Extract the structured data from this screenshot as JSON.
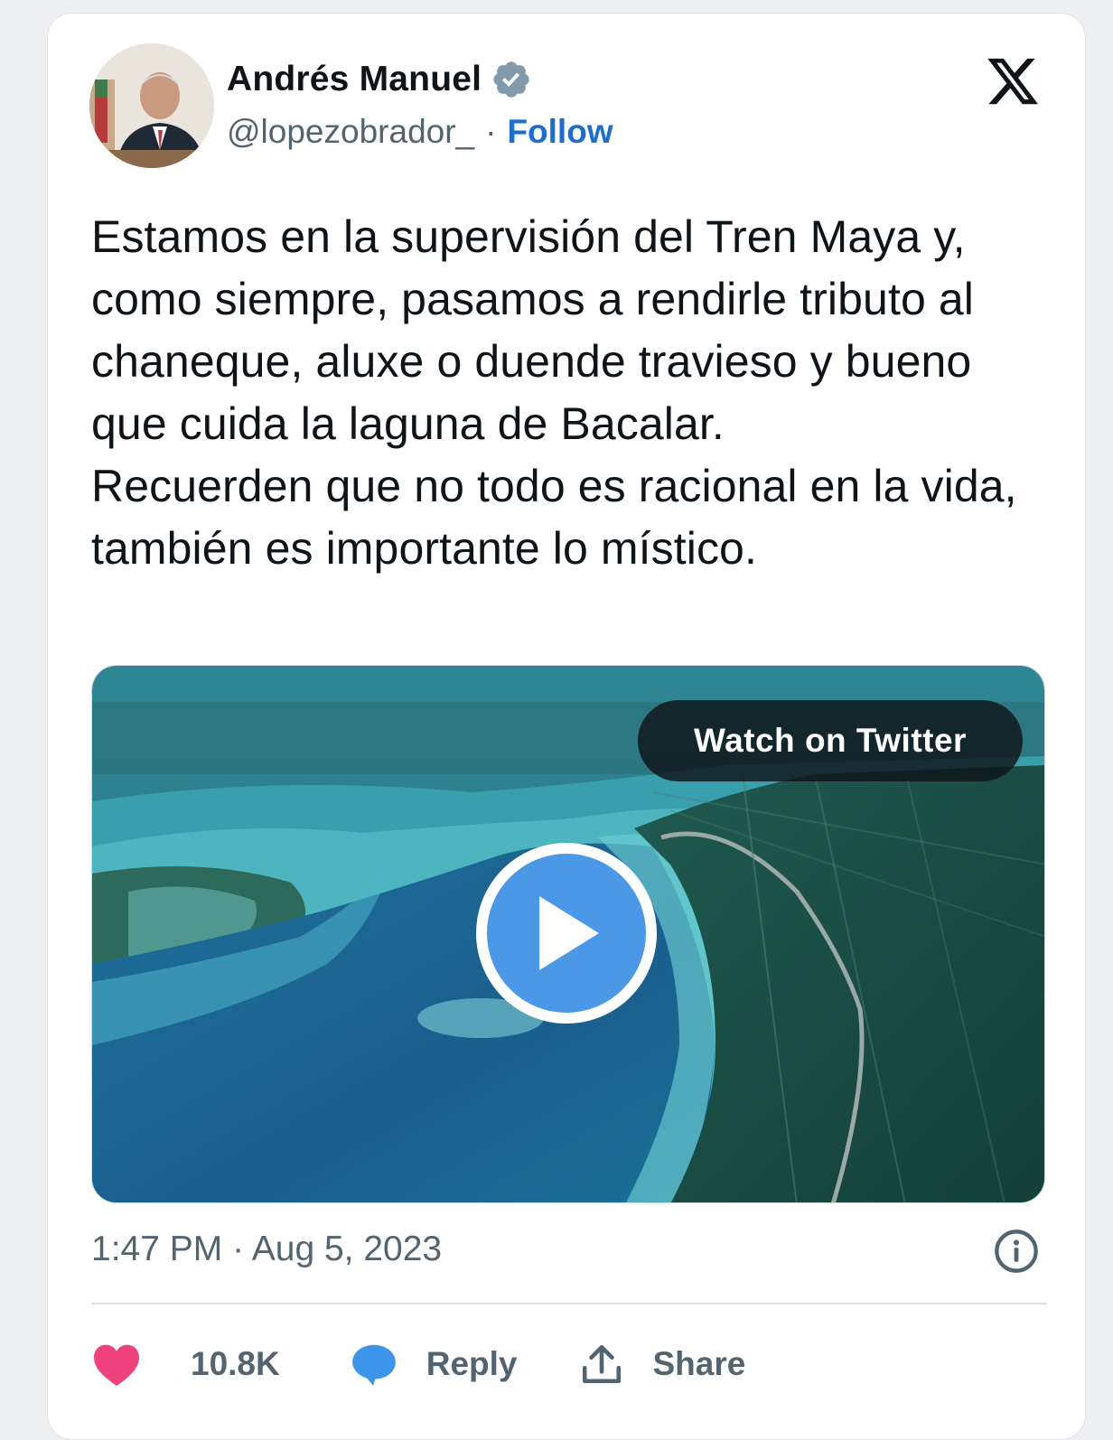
{
  "author": {
    "name": "Andrés Manuel",
    "handle": "@lopezobrador_",
    "separator": "·",
    "follow_label": "Follow",
    "verified_color": "#829aab"
  },
  "tweet": {
    "paragraphs": [
      "Estamos en la supervisión del Tren Maya y, como siempre, pasamos a rendirle tributo al chaneque, aluxe o duende travieso y bueno que cuida la laguna de Bacalar.",
      "Recuerden que no todo es racional en la vida, también es importante lo místico."
    ]
  },
  "media": {
    "watch_label": "Watch on Twitter",
    "play_color": "#4a98e6"
  },
  "meta": {
    "timestamp": "1:47 PM · Aug 5, 2023"
  },
  "actions": {
    "like_count": "10.8K",
    "reply_label": "Reply",
    "share_label": "Share",
    "like_color": "#f0417f",
    "reply_color": "#3d95ea"
  }
}
